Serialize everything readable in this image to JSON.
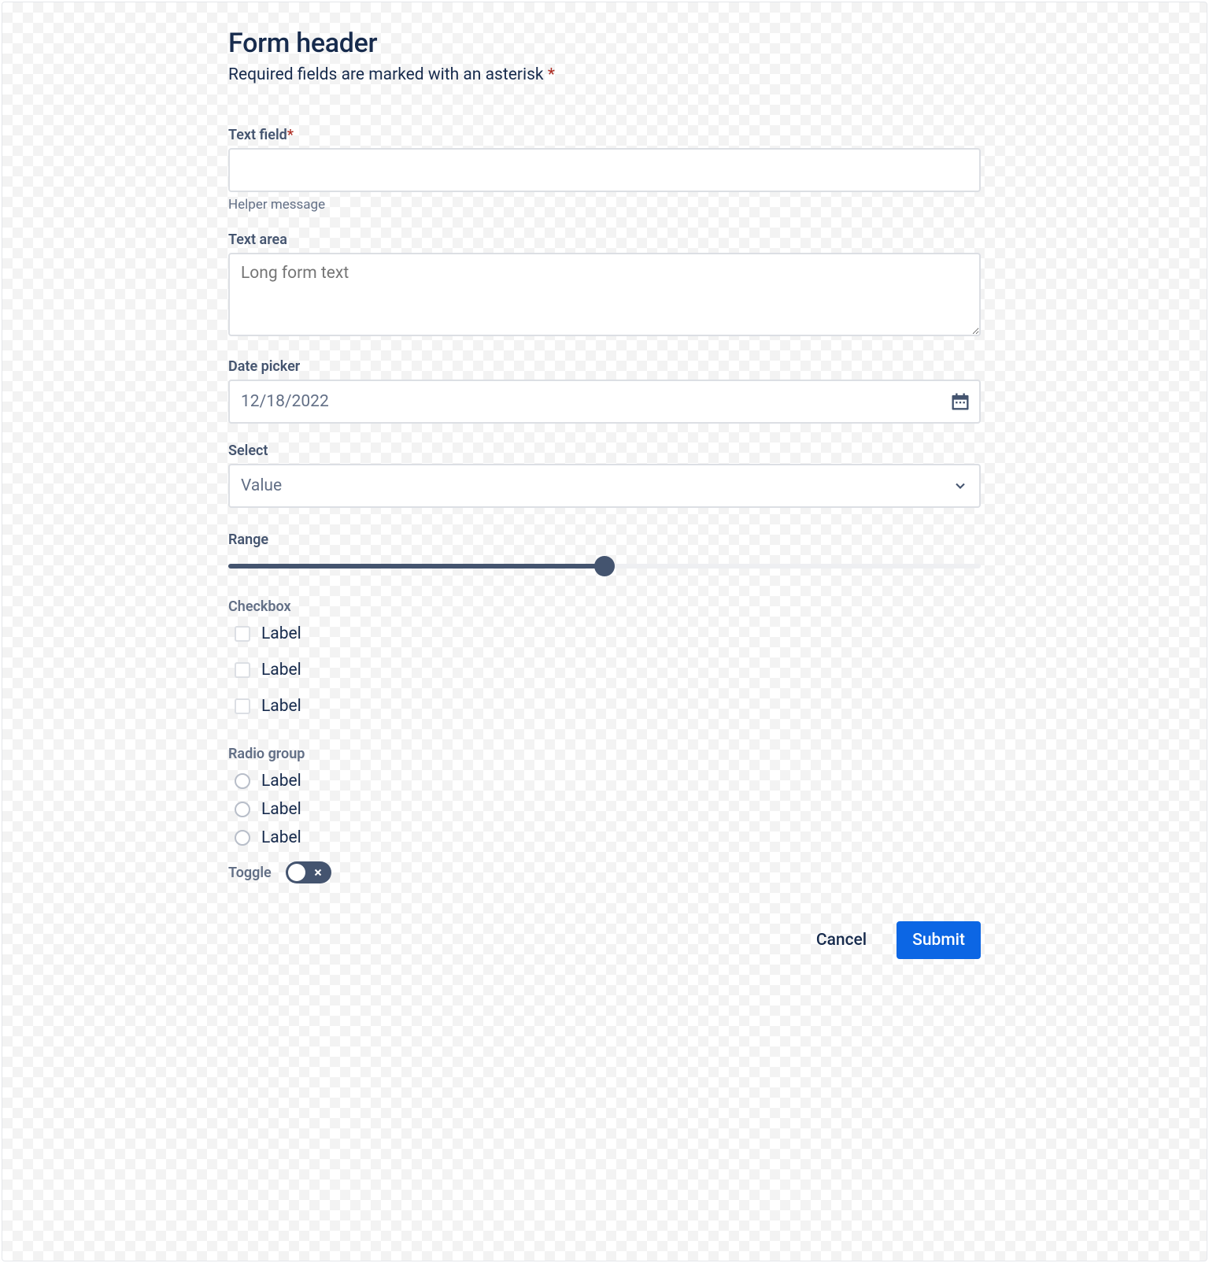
{
  "header": {
    "title": "Form header",
    "required_note": "Required fields are marked with an asterisk",
    "asterisk": "*"
  },
  "fields": {
    "text_field": {
      "label": "Text field",
      "required_mark": "*",
      "value": "",
      "helper": "Helper message"
    },
    "text_area": {
      "label": "Text area",
      "placeholder": "Long form text"
    },
    "date_picker": {
      "label": "Date picker",
      "value": "12/18/2022"
    },
    "select": {
      "label": "Select",
      "value": "Value"
    },
    "range": {
      "label": "Range",
      "percent": 50
    },
    "checkbox": {
      "group_label": "Checkbox",
      "options": [
        {
          "label": "Label"
        },
        {
          "label": "Label"
        },
        {
          "label": "Label"
        }
      ]
    },
    "radio": {
      "group_label": "Radio group",
      "options": [
        {
          "label": "Label"
        },
        {
          "label": "Label"
        },
        {
          "label": "Label"
        }
      ]
    },
    "toggle": {
      "label": "Toggle",
      "on": false
    }
  },
  "footer": {
    "cancel": "Cancel",
    "submit": "Submit"
  }
}
